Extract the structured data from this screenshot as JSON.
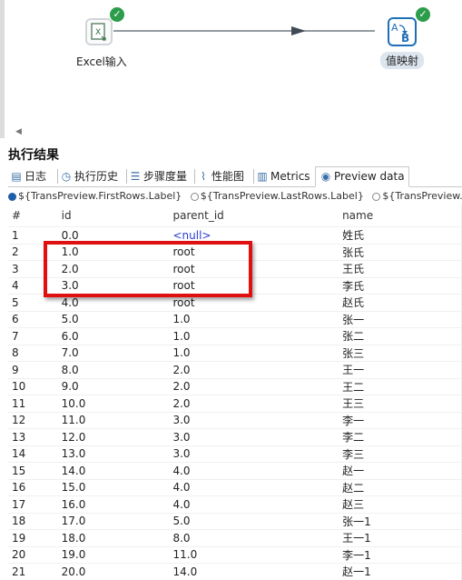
{
  "canvas": {
    "steps": [
      {
        "label": "Excel输入",
        "icon": "excel-input-icon",
        "status": "ok"
      },
      {
        "label": "值映射",
        "icon": "value-mapper-icon",
        "status": "ok"
      }
    ]
  },
  "results": {
    "title": "执行结果",
    "tabs": [
      {
        "label": "日志",
        "icon": "log-icon"
      },
      {
        "label": "执行历史",
        "icon": "history-icon"
      },
      {
        "label": "步骤度量",
        "icon": "step-metrics-icon"
      },
      {
        "label": "性能图",
        "icon": "performance-graph-icon"
      },
      {
        "label": "Metrics",
        "icon": "metrics-icon"
      },
      {
        "label": "Preview data",
        "icon": "eye-icon"
      }
    ],
    "radios": [
      "${TransPreview.FirstRows.Label}",
      "${TransPreview.LastRows.Label}",
      "${TransPreview."
    ],
    "table": {
      "columns": [
        "#",
        "id",
        "parent_id",
        "name"
      ],
      "rows": [
        [
          "1",
          "0.0",
          "<null>",
          "姓氏"
        ],
        [
          "2",
          "1.0",
          "root",
          "张氏"
        ],
        [
          "3",
          "2.0",
          "root",
          "王氏"
        ],
        [
          "4",
          "3.0",
          "root",
          "李氏"
        ],
        [
          "5",
          "4.0",
          "root",
          "赵氏"
        ],
        [
          "6",
          "5.0",
          "1.0",
          "张一"
        ],
        [
          "7",
          "6.0",
          "1.0",
          "张二"
        ],
        [
          "8",
          "7.0",
          "1.0",
          "张三"
        ],
        [
          "9",
          "8.0",
          "2.0",
          "王一"
        ],
        [
          "10",
          "9.0",
          "2.0",
          "王二"
        ],
        [
          "11",
          "10.0",
          "2.0",
          "王三"
        ],
        [
          "12",
          "11.0",
          "3.0",
          "李一"
        ],
        [
          "13",
          "12.0",
          "3.0",
          "李二"
        ],
        [
          "14",
          "13.0",
          "3.0",
          "李三"
        ],
        [
          "15",
          "14.0",
          "4.0",
          "赵一"
        ],
        [
          "16",
          "15.0",
          "4.0",
          "赵二"
        ],
        [
          "17",
          "16.0",
          "4.0",
          "赵三"
        ],
        [
          "18",
          "17.0",
          "5.0",
          "张一1"
        ],
        [
          "19",
          "18.0",
          "8.0",
          "王一1"
        ],
        [
          "20",
          "19.0",
          "11.0",
          "李一1"
        ],
        [
          "21",
          "20.0",
          "14.0",
          "赵一1"
        ]
      ]
    }
  },
  "colors": {
    "highlight": "#e01010",
    "null_text": "#2b3bd8",
    "ok": "#2c9d4a"
  }
}
